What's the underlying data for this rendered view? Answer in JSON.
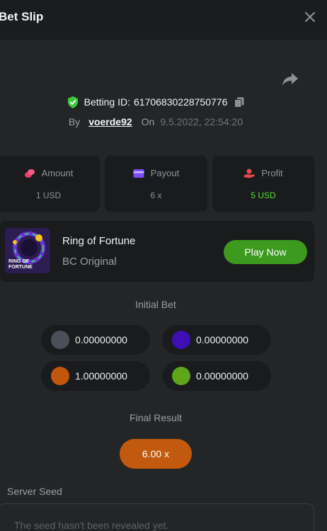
{
  "header": {
    "title": "Bet Slip"
  },
  "bet": {
    "betting_id_label": "Betting ID:",
    "betting_id": "61706830228750776",
    "by_label": "By",
    "user": "voerde92",
    "on_label": "On",
    "datetime": "9.5.2022, 22:54:20"
  },
  "stats": {
    "amount_label": "Amount",
    "amount_value": "1 USD",
    "payout_label": "Payout",
    "payout_value": "6 x",
    "profit_label": "Profit",
    "profit_value": "5 USD"
  },
  "game": {
    "name": "Ring of Fortune",
    "provider": "BC Original",
    "play_label": "Play Now",
    "thumb_text_1": "RING OF",
    "thumb_text_2": "FORTUNE"
  },
  "initial_bet": {
    "title": "Initial Bet",
    "chips": [
      {
        "color": "#4b5058",
        "value": "0.00000000"
      },
      {
        "color": "#3e0fb5",
        "value": "0.00000000"
      },
      {
        "color": "#c1560e",
        "value": "1.00000000"
      },
      {
        "color": "#5ea51a",
        "value": "0.00000000"
      }
    ]
  },
  "final_result": {
    "title": "Final Result",
    "value": "6.00 x"
  },
  "server_seed": {
    "label": "Server Seed",
    "placeholder": "The seed hasn't been revealed yet."
  },
  "colors": {
    "accent_green": "#5bdc3a",
    "play_green": "#3c9a1f",
    "result_orange": "#c15a0f"
  }
}
